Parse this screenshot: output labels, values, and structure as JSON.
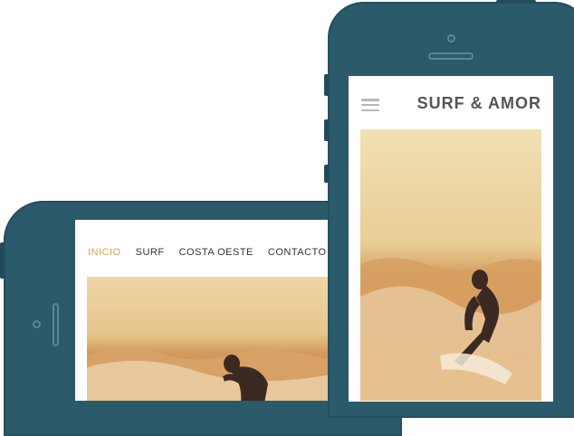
{
  "landscape_phone": {
    "nav": [
      {
        "label": "INICIO",
        "active": true
      },
      {
        "label": "SURF",
        "active": false
      },
      {
        "label": "COSTA OESTE",
        "active": false
      },
      {
        "label": "CONTACTO",
        "active": false
      }
    ],
    "accent_color": "#d9a55a"
  },
  "portrait_phone": {
    "site_title": "SURF & AMOR",
    "menu_icon": "hamburger-menu-icon"
  },
  "colors": {
    "device_body": "#2b5a6b",
    "photo_sky": "#f3dca8",
    "photo_wave": "#c98a4a"
  }
}
